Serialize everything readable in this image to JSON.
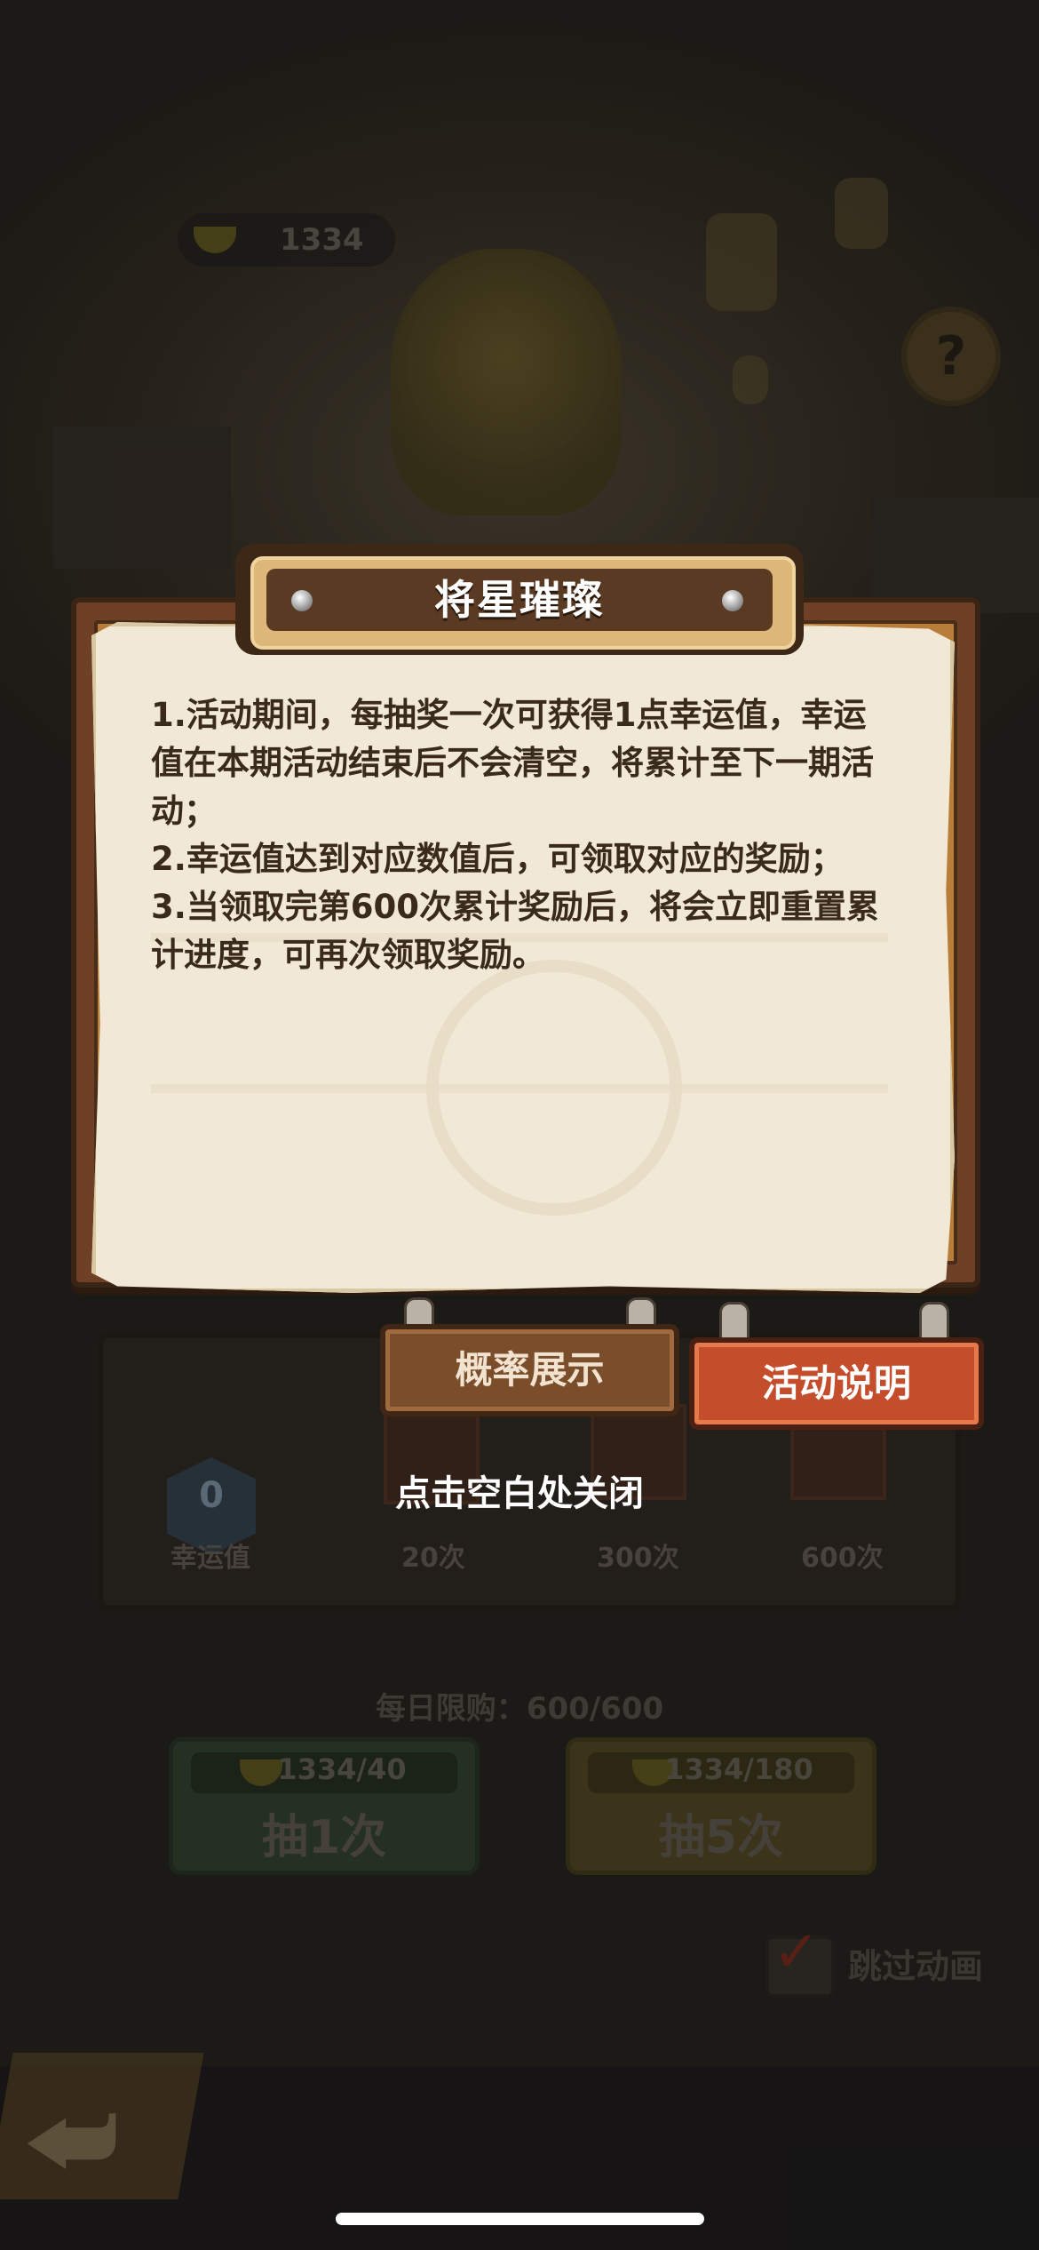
{
  "background": {
    "currency_amount": "1334",
    "lucky_value": "0",
    "lucky_label": "幸运值",
    "milestones": [
      "20次",
      "300次",
      "600次"
    ],
    "daily_limit": "每日限购：600/600",
    "draw_one": {
      "cost": "1334/40",
      "label": "抽1次"
    },
    "draw_five": {
      "cost": "1334/180",
      "label": "抽5次"
    },
    "skip_animation_label": "跳过动画",
    "help_symbol": "?"
  },
  "modal": {
    "title": "将星璀璨",
    "rules": [
      "1.活动期间，每抽奖一次可获得1点幸运值，幸运值在本期活动结束后不会清空，将累计至下一期活动；",
      "2.幸运值达到对应数值后，可领取对应的奖励；",
      "3.当领取完第600次累计奖励后，将会立即重置累计进度，可再次领取奖励。"
    ],
    "tabs": {
      "probability": "概率展示",
      "description": "活动说明"
    },
    "close_hint": "点击空白处关闭"
  },
  "colors": {
    "active_tab": "#c44d2c",
    "inactive_tab": "#7a4d2b",
    "parchment": "#f1e8d6",
    "frame": "#6e4126"
  },
  "icons": [
    "ingot-icon",
    "help-icon",
    "back-arrow-icon",
    "checkbox-icon"
  ]
}
